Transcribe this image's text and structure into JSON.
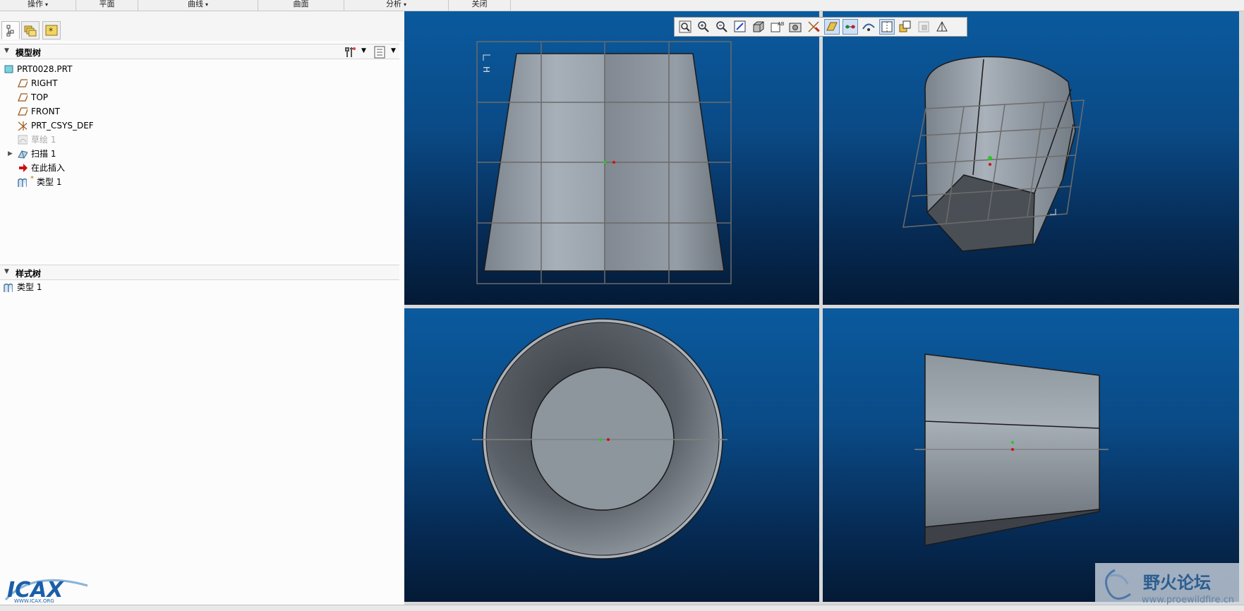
{
  "menubar": {
    "items": [
      {
        "label": "操作",
        "dropdown": true
      },
      {
        "label": "平面",
        "dropdown": false
      },
      {
        "label": "曲线",
        "dropdown": true
      },
      {
        "label": "曲面",
        "dropdown": false
      },
      {
        "label": "分析",
        "dropdown": true
      },
      {
        "label": "关闭",
        "dropdown": false
      }
    ]
  },
  "model_tree": {
    "title": "模型树",
    "items": [
      {
        "label": "PRT0028.PRT",
        "icon": "part-icon"
      },
      {
        "label": "RIGHT",
        "icon": "datum-plane-icon"
      },
      {
        "label": "TOP",
        "icon": "datum-plane-icon"
      },
      {
        "label": "FRONT",
        "icon": "datum-plane-icon"
      },
      {
        "label": "PRT_CSYS_DEF",
        "icon": "coordinate-system-icon"
      },
      {
        "label": "草绘 1",
        "icon": "sketch-icon",
        "disabled": true
      },
      {
        "label": "扫描 1",
        "icon": "sweep-icon",
        "expandable": true
      },
      {
        "label": "在此插入",
        "icon": "insert-here-arrow-icon"
      },
      {
        "label": "类型 1",
        "icon": "style-feature-icon",
        "marker": "*"
      }
    ]
  },
  "style_tree": {
    "title": "样式树",
    "items": [
      {
        "label": "类型 1",
        "icon": "style-feature-icon"
      }
    ]
  },
  "viewport": {
    "grid_label": "H"
  },
  "watermark": {
    "title": "野火论坛",
    "url": "www.proewildfire.cn"
  },
  "logo": {
    "text": "ICAX",
    "subtext": "WWW.ICAX.ORG"
  },
  "colors": {
    "viewport_top": "#0a5a9e",
    "viewport_bottom": "#041a35",
    "model_gray": "#8f979f",
    "accent_red": "#cc1111"
  }
}
